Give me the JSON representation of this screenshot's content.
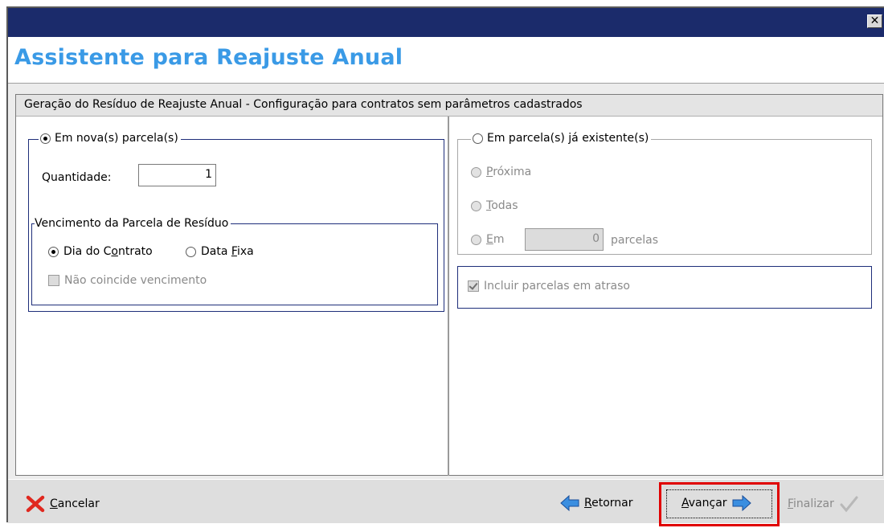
{
  "window": {
    "title": "Assistente para Reajuste Anual",
    "close_label": "✕"
  },
  "section": {
    "header": "Geração do Resíduo de Reajuste Anual - Configuração para contratos sem parâmetros cadastrados"
  },
  "left": {
    "new_installments": {
      "label": "Em nova(s) parcela(s)",
      "checked": true
    },
    "quantity": {
      "label": "Quantidade:",
      "value": "1"
    },
    "due_group": {
      "label": "Vencimento da Parcela de Resíduo",
      "contract_day": {
        "label_pre": "Dia do C",
        "label_u": "o",
        "label_post": "ntrato",
        "checked": true
      },
      "fixed_date": {
        "label_pre": "Data ",
        "label_u": "F",
        "label_post": "ixa",
        "checked": false
      },
      "not_coincide": {
        "label": "Não coincide vencimento",
        "checked": false,
        "disabled": true
      }
    }
  },
  "right": {
    "existing_installments": {
      "label": "Em parcela(s) já existente(s)",
      "checked": false
    },
    "next": {
      "label_u": "P",
      "label_post": "róxima",
      "disabled": true
    },
    "all": {
      "label_u": "T",
      "label_post": "odas",
      "disabled": true
    },
    "in": {
      "label_u": "E",
      "label_post": "m",
      "value": "0",
      "suffix": "parcelas",
      "disabled": true
    },
    "include_overdue": {
      "label": "Incluir parcelas em atraso",
      "checked": true,
      "disabled": true
    }
  },
  "footer": {
    "cancel": {
      "label_u": "C",
      "label_post": "ancelar"
    },
    "back": {
      "label_u": "R",
      "label_post": "etornar"
    },
    "next": {
      "label_u": "A",
      "label_post": "vançar"
    },
    "finish": {
      "label_u": "F",
      "label_post": "inalizar",
      "disabled": true
    }
  },
  "colors": {
    "title_text": "#3a9ae6",
    "titlebar": "#1b2b6b",
    "highlight": "#e00000",
    "group_border": "#1e2e7a"
  }
}
